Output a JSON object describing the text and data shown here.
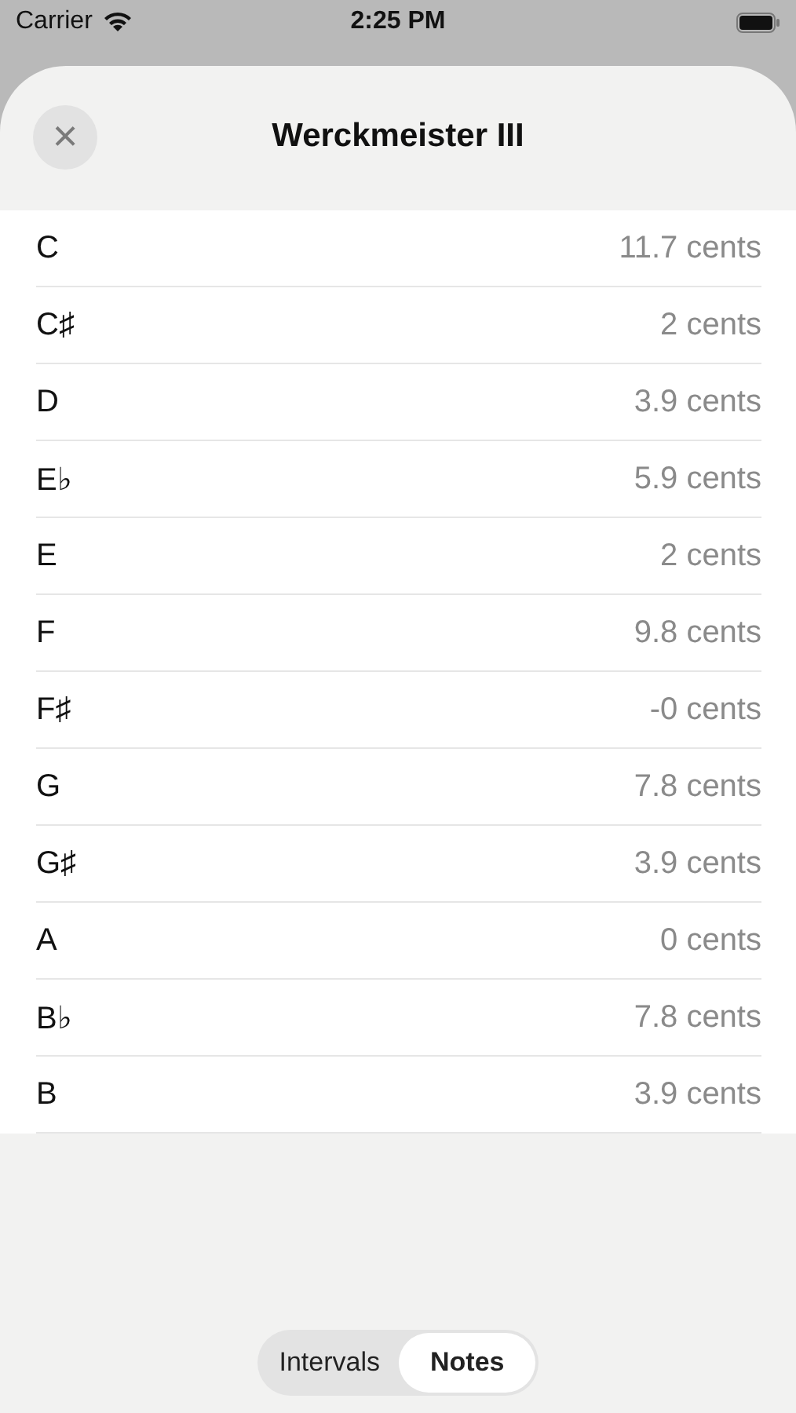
{
  "status_bar": {
    "carrier": "Carrier",
    "time": "2:25 PM"
  },
  "sheet": {
    "title": "Werckmeister III",
    "close": "×"
  },
  "notes": [
    {
      "name": "C",
      "offset": "11.7 cents"
    },
    {
      "name": "C♯",
      "offset": "2 cents"
    },
    {
      "name": "D",
      "offset": "3.9 cents"
    },
    {
      "name": "E♭",
      "offset": "5.9 cents"
    },
    {
      "name": "E",
      "offset": "2 cents"
    },
    {
      "name": "F",
      "offset": "9.8 cents"
    },
    {
      "name": "F♯",
      "offset": "-0 cents"
    },
    {
      "name": "G",
      "offset": "7.8 cents"
    },
    {
      "name": "G♯",
      "offset": "3.9 cents"
    },
    {
      "name": "A",
      "offset": "0 cents"
    },
    {
      "name": "B♭",
      "offset": "7.8 cents"
    },
    {
      "name": "B",
      "offset": "3.9 cents"
    }
  ],
  "segments": [
    {
      "label": "Intervals",
      "selected": false
    },
    {
      "label": "Notes",
      "selected": true
    }
  ]
}
